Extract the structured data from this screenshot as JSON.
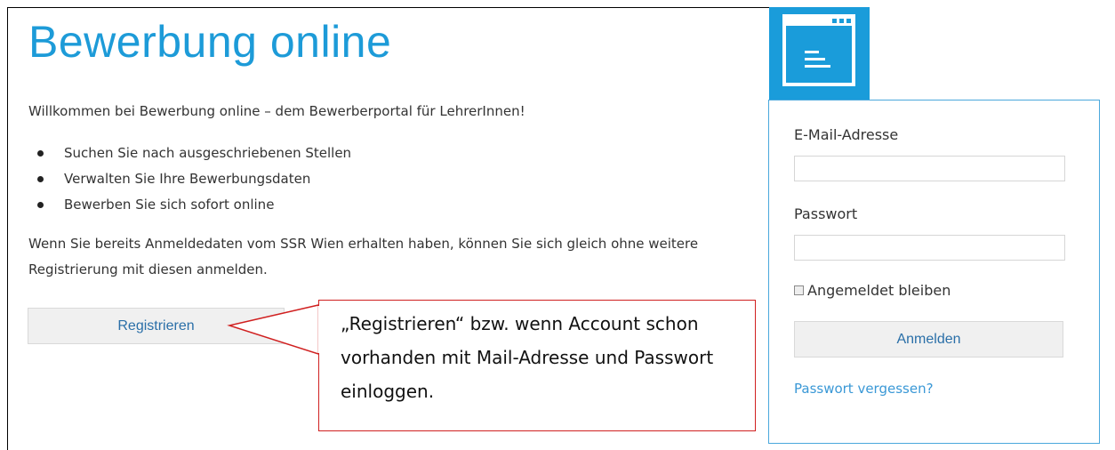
{
  "page": {
    "title": "Bewerbung online",
    "welcome": "Willkommen bei Bewerbung online – dem Bewerberportal für LehrerInnen!",
    "features": [
      "Suchen Sie nach ausgeschriebenen Stellen",
      "Verwalten Sie Ihre Bewerbungsdaten",
      "Bewerben Sie sich sofort online"
    ],
    "info": "Wenn Sie bereits Anmeldedaten vom SSR Wien erhalten haben, können Sie sich gleich ohne weitere Registrierung mit diesen anmelden.",
    "register_label": "Registrieren"
  },
  "callout": {
    "text": "„Registrieren“ bzw. wenn Account schon vorhanden mit Mail-Adresse und Passwort einloggen.",
    "border_color": "#d02020"
  },
  "login": {
    "email_label": "E-Mail-Adresse",
    "email_value": "",
    "password_label": "Passwort",
    "password_value": "",
    "remember_label": "Angemeldet bleiben",
    "remember_checked": false,
    "submit_label": "Anmelden",
    "forgot_label": "Passwort vergessen?"
  },
  "icons": {
    "app_tile": "app-window-icon"
  },
  "colors": {
    "accent": "#1d9bd8",
    "tile": "#1a9cda",
    "link": "#3a98d6",
    "button_bg": "#f0f0f0"
  }
}
